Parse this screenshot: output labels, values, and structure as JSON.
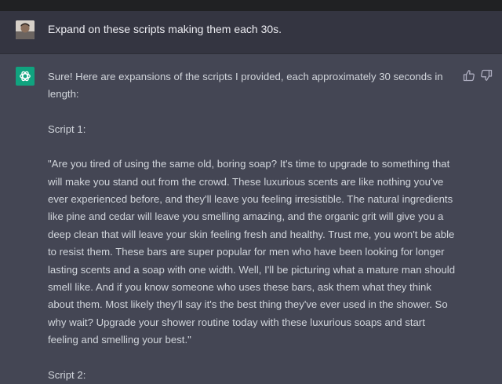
{
  "user_message": {
    "text": "Expand on these scripts making them each 30s."
  },
  "assistant_message": {
    "intro": "Sure! Here are expansions of the scripts I provided, each approximately 30 seconds in length:",
    "script1_heading": "Script 1:",
    "script1_body": "\"Are you tired of using the same old, boring soap? It's time to upgrade to something that will make you stand out from the crowd. These luxurious scents are like nothing you've ever experienced before, and they'll leave you feeling irresistible. The natural ingredients like pine and cedar will leave you smelling amazing, and the organic grit will give you a deep clean that will leave your skin feeling fresh and healthy. Trust me, you won't be able to resist them. These bars are super popular for men who have been looking for longer lasting scents and a soap with one width. Well, I'll be picturing what a mature man should smell like. And if you know someone who uses these bars, ask them what they think about them. Most likely they'll say it's the best thing they've ever used in the shower. So why wait? Upgrade your shower routine today with these luxurious soaps and start feeling and smelling your best.\"",
    "script2_heading": "Script 2:"
  },
  "icons": {
    "user_avatar": "user-avatar",
    "assistant_avatar": "openai-logo-icon",
    "thumbs_up": "thumbs-up-icon",
    "thumbs_down": "thumbs-down-icon"
  },
  "colors": {
    "user_bg": "#343541",
    "assistant_bg": "#444654",
    "bot_avatar_bg": "#10a37f",
    "text": "#d1d5db"
  }
}
